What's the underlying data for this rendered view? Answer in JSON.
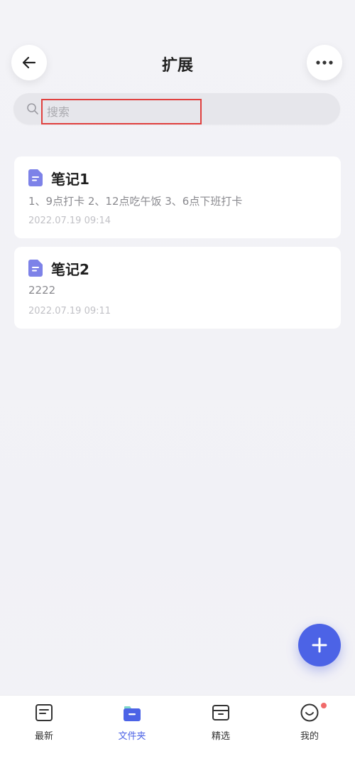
{
  "header": {
    "title": "扩展"
  },
  "search": {
    "placeholder": "搜索"
  },
  "notes": [
    {
      "title": "笔记1",
      "preview": "1、9点打卡 2、12点吃午饭 3、6点下班打卡",
      "date": "2022.07.19 09:14"
    },
    {
      "title": "笔记2",
      "preview": "2222",
      "date": "2022.07.19 09:11"
    }
  ],
  "bottom_nav": {
    "items": [
      {
        "label": "最新",
        "icon": "note-icon"
      },
      {
        "label": "文件夹",
        "icon": "folder-icon",
        "active": true
      },
      {
        "label": "精选",
        "icon": "box-icon"
      },
      {
        "label": "我的",
        "icon": "smile-icon"
      }
    ]
  },
  "colors": {
    "accent": "#4c63e6",
    "note_icon": "#7d82e8",
    "badge": "#f06a6a",
    "highlight_border": "#e0403e"
  }
}
